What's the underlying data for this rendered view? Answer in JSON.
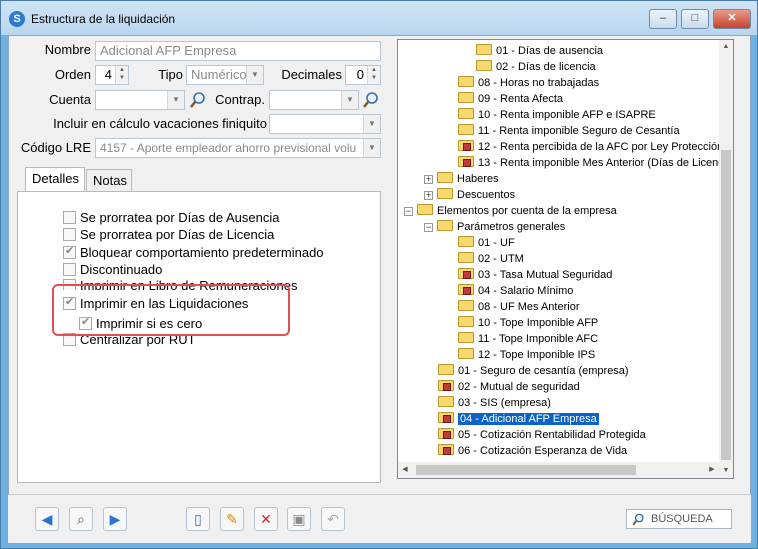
{
  "window": {
    "title": "Estructura de la liquidación",
    "minimize": "–",
    "maximize": "□",
    "close": "✕",
    "app_icon": "app-swirl-icon"
  },
  "form": {
    "nombre_label": "Nombre",
    "nombre_value": "Adicional AFP Empresa",
    "orden_label": "Orden",
    "orden_value": "4",
    "tipo_label": "Tipo",
    "tipo_value": "Numérico",
    "decimales_label": "Decimales",
    "decimales_value": "0",
    "cuenta_label": "Cuenta",
    "cuenta_value": "",
    "contrap_label": "Contrap.",
    "contrap_value": "",
    "vacaciones_label": "Incluir en cálculo vacaciones finiquito",
    "vacaciones_value": "",
    "lre_label": "Código LRE",
    "lre_value": "4157 - Aporte empleador ahorro previsional volu"
  },
  "tabs": [
    {
      "label": "Detalles",
      "active": true
    },
    {
      "label": "Notas",
      "active": false
    }
  ],
  "checkboxes": [
    {
      "label": "Se prorratea por Días de Ausencia",
      "checked": false
    },
    {
      "label": "Se prorratea por Días de Licencia",
      "checked": false
    },
    {
      "label": "Bloquear comportamiento predeterminado",
      "checked": true
    },
    {
      "label": "Discontinuado",
      "checked": false
    },
    {
      "label": "Imprimir en Libro de Remuneraciones",
      "checked": false
    },
    {
      "label": "Imprimir en las Liquidaciones",
      "checked": true
    },
    {
      "label": "Imprimir si es cero",
      "checked": true
    },
    {
      "label": "Centralizar por RUT",
      "checked": false
    }
  ],
  "tree": [
    {
      "label": "01 - Días de ausencia",
      "locked": false
    },
    {
      "label": "02 - Días de licencia",
      "locked": false
    },
    {
      "label": "08 - Horas no trabajadas",
      "locked": false
    },
    {
      "label": "09 - Renta Afecta",
      "locked": false
    },
    {
      "label": "10 - Renta imponible AFP e ISAPRE",
      "locked": false
    },
    {
      "label": "11 - Renta imponible Seguro de Cesantía",
      "locked": false
    },
    {
      "label": "12 - Renta percibida de la AFC por Ley Protección",
      "locked": true
    },
    {
      "label": "13 - Renta imponible Mes Anterior (Días de Licenc",
      "locked": true
    },
    {
      "label": "Haberes",
      "locked": false,
      "expander": "+"
    },
    {
      "label": "Descuentos",
      "locked": false,
      "expander": "+"
    },
    {
      "label": "Elementos por cuenta de la empresa",
      "locked": false,
      "expander": "−"
    },
    {
      "label": "Parámetros generales",
      "locked": false,
      "expander": "−"
    },
    {
      "label": "01 - UF",
      "locked": false
    },
    {
      "label": "02 - UTM",
      "locked": false
    },
    {
      "label": "03 - Tasa Mutual Seguridad",
      "locked": true
    },
    {
      "label": "04 - Salario Mínimo",
      "locked": true
    },
    {
      "label": "08 - UF Mes Anterior",
      "locked": false
    },
    {
      "label": "10 - Tope Imponible AFP",
      "locked": false
    },
    {
      "label": "11 - Tope Imponible AFC",
      "locked": false
    },
    {
      "label": "12 - Tope Imponible IPS",
      "locked": false
    },
    {
      "label": "01 - Seguro de cesantía (empresa)",
      "locked": false
    },
    {
      "label": "02 - Mutual de seguridad",
      "locked": true
    },
    {
      "label": "03 - SIS (empresa)",
      "locked": false
    },
    {
      "label": "04 - Adicional AFP Empresa",
      "locked": true,
      "selected": true
    },
    {
      "label": "05 - Cotización Rentabilidad Protegida",
      "locked": true
    },
    {
      "label": "06 - Cotización Esperanza de Vida",
      "locked": true
    }
  ],
  "toolbar": {
    "search_label": "BÚSQUEDA",
    "buttons": [
      "back-arrow-icon",
      "binoculars-icon",
      "forward-arrow-icon",
      "new-document-icon",
      "pencil-edit-icon",
      "delete-x-icon",
      "save-disk-icon",
      "undo-icon"
    ]
  }
}
